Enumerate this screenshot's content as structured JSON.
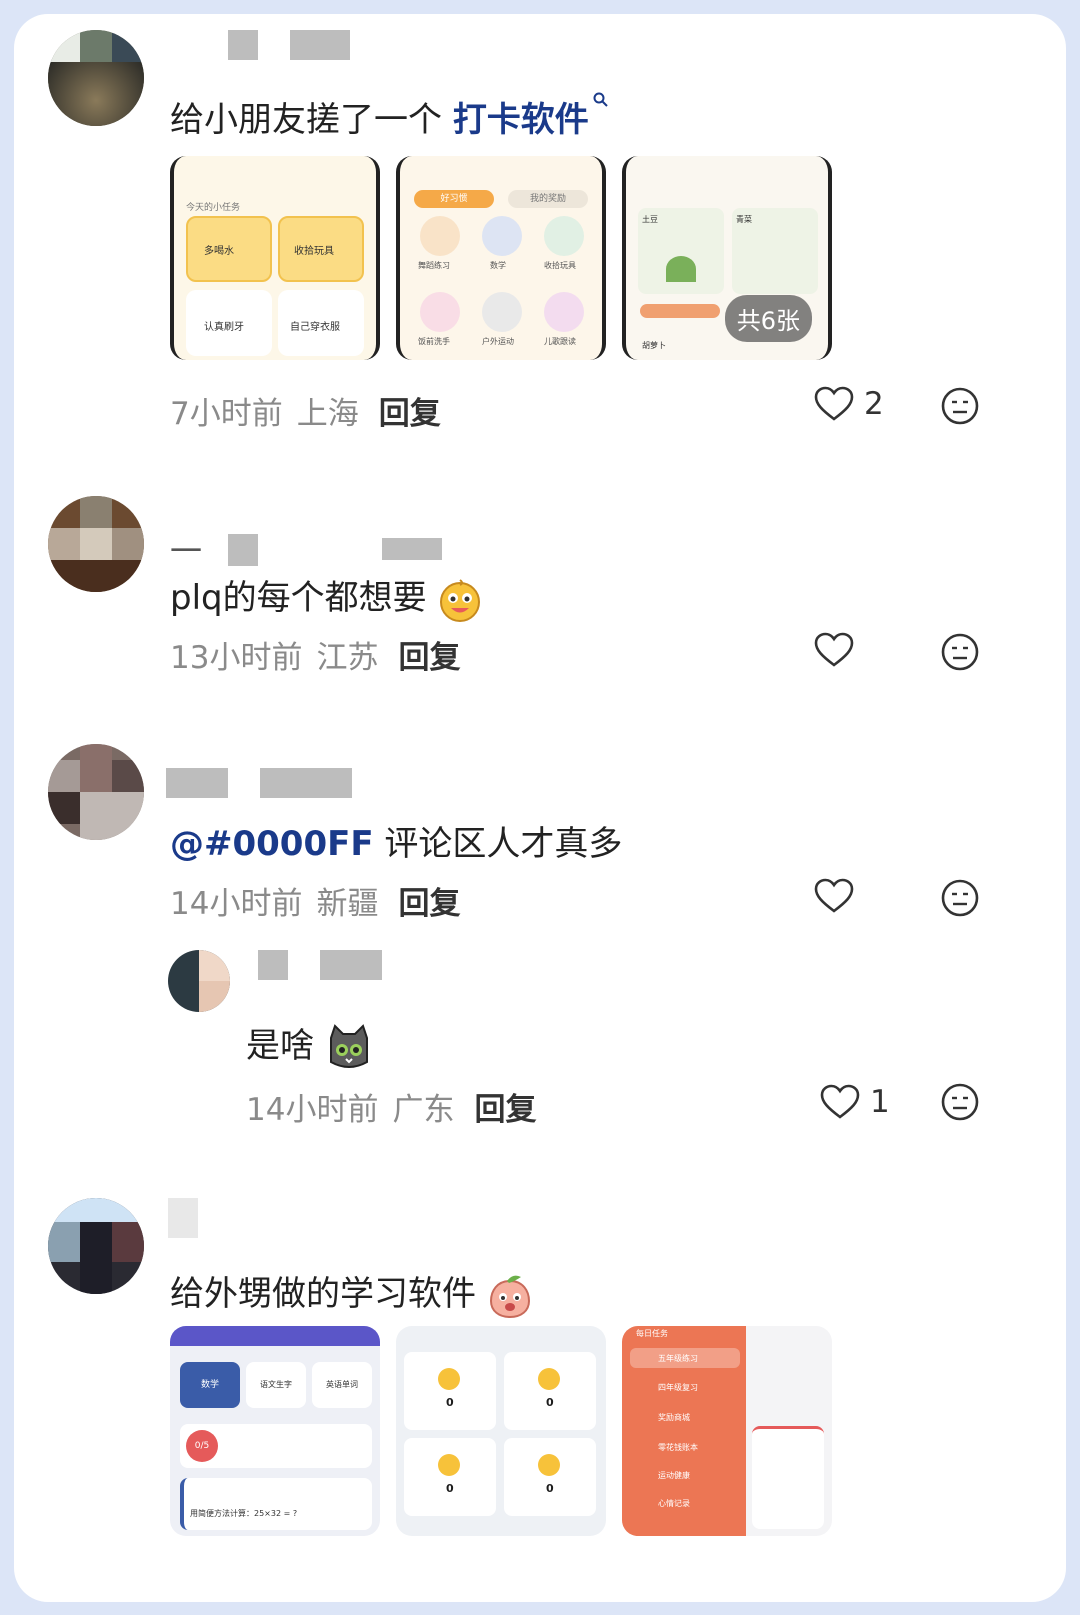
{
  "comments": [
    {
      "text_prefix": "给小朋友搓了一个 ",
      "link": "打卡软件",
      "time": "7小时前",
      "location": "上海",
      "reply": "回复",
      "likes": "2",
      "badge": "共6张",
      "thumb1": {
        "header": "今天的小任务",
        "items": [
          "多喝水",
          "收拾玩具",
          "认真刷牙",
          "自己穿衣服"
        ]
      },
      "thumb2": {
        "tabs": [
          "好习惯",
          "我的奖励"
        ],
        "items": [
          "舞蹈练习",
          "数学",
          "收拾玩具",
          "饭前洗手",
          "户外运动",
          "儿歌跟读"
        ]
      },
      "thumb3": {
        "items": [
          "土豆",
          "青菜",
          "胡萝卜"
        ]
      }
    },
    {
      "name_frag": "一",
      "text": "plq的每个都想要",
      "time": "13小时前",
      "location": "江苏",
      "reply": "回复"
    },
    {
      "mention": "@#0000FF",
      "text": " 评论区人才真多",
      "time": "14小时前",
      "location": "新疆",
      "reply": "回复"
    },
    {
      "text": "是啥",
      "time": "14小时前",
      "location": "广东",
      "reply": "回复",
      "likes": "1"
    },
    {
      "text": "给外甥做的学习软件",
      "thumb1": {
        "items": [
          "数学",
          "语文生字",
          "英语单词"
        ],
        "progress": "0/5",
        "question": "用简便方法计算：25×32 = ?"
      },
      "thumb2": {
        "values": [
          "0",
          "0",
          "0",
          "0"
        ]
      },
      "thumb3": {
        "items": [
          "每日任务",
          "五年级练习",
          "四年级复习",
          "奖励商城",
          "零花钱账本",
          "运动健康",
          "心情记录"
        ]
      }
    }
  ]
}
